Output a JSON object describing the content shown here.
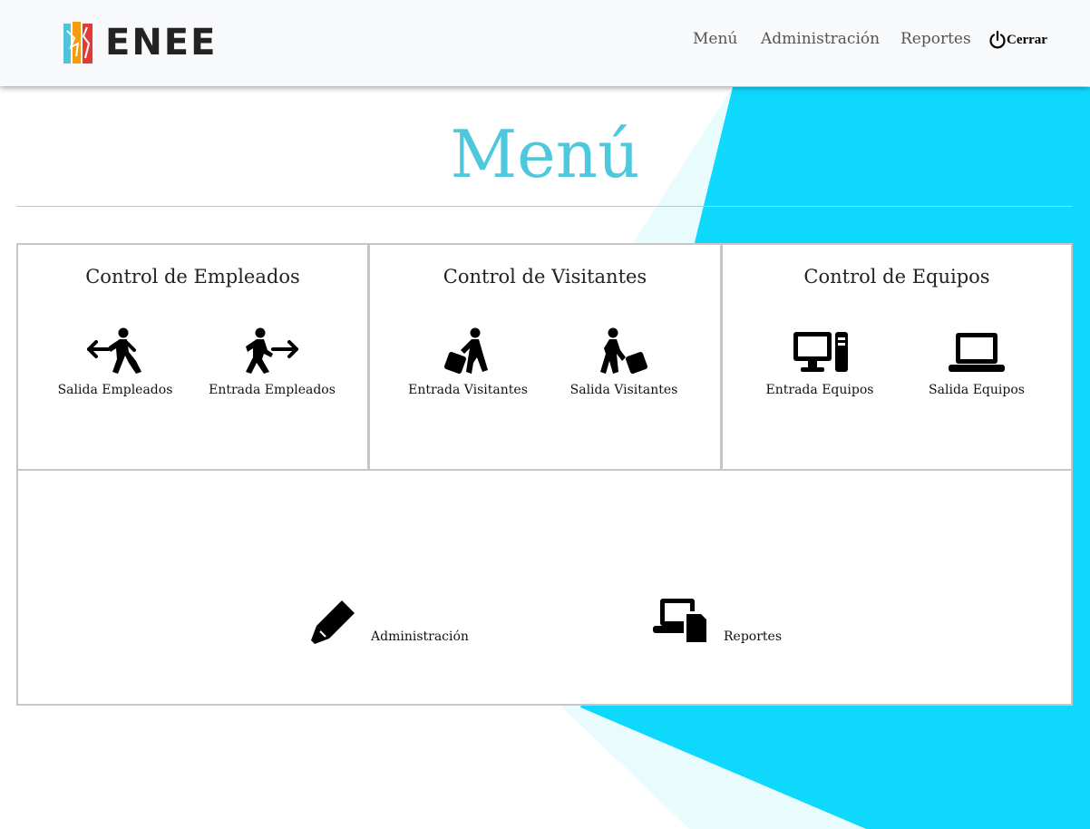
{
  "brand": {
    "name": "ENEE"
  },
  "nav": {
    "items": [
      {
        "label": "Menú"
      },
      {
        "label": "Administración"
      },
      {
        "label": "Reportes"
      }
    ],
    "logout_label": "Cerrar"
  },
  "page": {
    "title": "Menú"
  },
  "panels": [
    {
      "title": "Control de Empleados",
      "items": [
        {
          "label": "Salida Empleados",
          "icon": "walking-exit-icon"
        },
        {
          "label": "Entrada Empleados",
          "icon": "walking-enter-icon"
        }
      ]
    },
    {
      "title": "Control de Visitantes",
      "items": [
        {
          "label": "Entrada Visitantes",
          "icon": "person-luggage-icon"
        },
        {
          "label": "Salida Visitantes",
          "icon": "person-luggage-icon"
        }
      ]
    },
    {
      "title": "Control de Equipos",
      "items": [
        {
          "label": "Entrada Equipos",
          "icon": "desktop-icon"
        },
        {
          "label": "Salida Equipos",
          "icon": "laptop-icon"
        }
      ]
    }
  ],
  "admin": {
    "items": [
      {
        "label": "Administración",
        "icon": "marker-icon"
      },
      {
        "label": "Reportes",
        "icon": "laptop-file-icon"
      }
    ]
  },
  "colors": {
    "accent": "#4ec8dc",
    "bg_band": "#0fd8fd",
    "bg_band_light": "#e8fcfd",
    "logo_blue": "#4fc3dc",
    "logo_orange": "#f39c12",
    "logo_red": "#e53935"
  }
}
